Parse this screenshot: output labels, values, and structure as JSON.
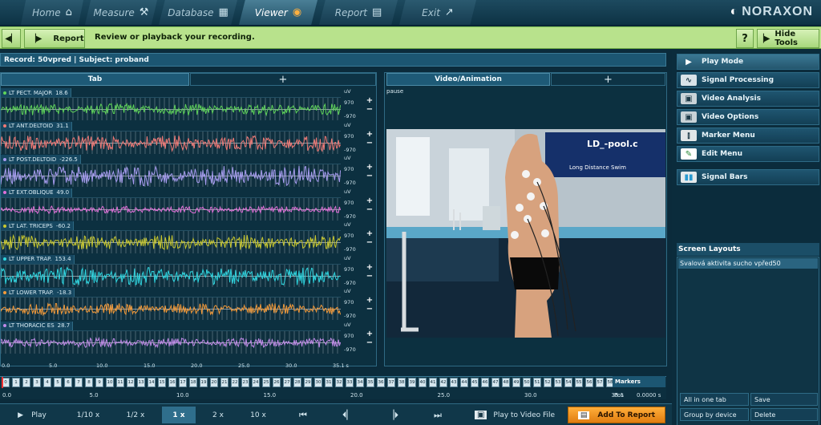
{
  "nav": {
    "tabs": [
      {
        "label": "Home",
        "icon": "home-icon"
      },
      {
        "label": "Measure",
        "icon": "measure-icon"
      },
      {
        "label": "Database",
        "icon": "database-icon"
      },
      {
        "label": "Viewer",
        "icon": "viewer-icon"
      },
      {
        "label": "Report",
        "icon": "report-icon"
      },
      {
        "label": "Exit",
        "icon": "exit-icon"
      }
    ],
    "active": "Viewer",
    "logo": "NORAXON"
  },
  "toolbar": {
    "report_label": "Report",
    "message": "Review or playback your recording.",
    "help": "?",
    "hide_tools": "Hide Tools"
  },
  "record": {
    "info": "Record: 50vpred | Subject: proband"
  },
  "signal_panel": {
    "tab_label": "Tab",
    "add_tab": "+",
    "unit": "uV",
    "scale_top": "970",
    "scale_bottom": "-970",
    "channels": [
      {
        "name": "LT PECT. MAJOR",
        "value": "18.6",
        "color": "#5fd35a"
      },
      {
        "name": "LT ANT.DELTOID",
        "value": "31.1",
        "color": "#f07a76"
      },
      {
        "name": "LT POST.DELTOID",
        "value": "-226.5",
        "color": "#a79cf0"
      },
      {
        "name": "LT EXT.OBLIQUE",
        "value": "49.0",
        "color": "#e070d8"
      },
      {
        "name": "LT LAT. TRICEPS",
        "value": "-60.2",
        "color": "#c9c830"
      },
      {
        "name": "LT UPPER TRAP.",
        "value": "153.4",
        "color": "#2fd6e0"
      },
      {
        "name": "LT LOWER TRAP.",
        "value": "-18.3",
        "color": "#f39a3a"
      },
      {
        "name": "LT THORACIC ES",
        "value": "28.7",
        "color": "#c08ae8"
      }
    ],
    "axis_ticks": [
      "0.0",
      "5.0",
      "10.0",
      "15.0",
      "20.0",
      "25.0",
      "30.0",
      "35.1 s"
    ]
  },
  "video_panel": {
    "tab_label": "Video/Animation",
    "add_tab": "+",
    "status": "pause",
    "banner_top": "LD_-pool.c",
    "banner_bottom": "Long Distance Swim"
  },
  "right_panel": {
    "items": [
      {
        "label": "Play Mode",
        "icon": "play-icon"
      },
      {
        "label": "Signal Processing",
        "icon": "signal-processing-icon"
      },
      {
        "label": "Video Analysis",
        "icon": "camera-icon"
      },
      {
        "label": "Video Options",
        "icon": "camera-icon"
      },
      {
        "label": "Marker Menu",
        "icon": "marker-icon"
      },
      {
        "label": "Edit Menu",
        "icon": "edit-icon"
      },
      {
        "label": "Signal Bars",
        "icon": "signal-bars-icon"
      }
    ],
    "screen_layouts_title": "Screen Layouts",
    "layouts": [
      "Svalová aktivita sucho vpřed50"
    ],
    "buttons": {
      "all_in_one_tab": "All in one tab",
      "save": "Save",
      "group_by_device": "Group by device",
      "delete": "Delete"
    }
  },
  "timeline": {
    "markers": [
      "0",
      "1",
      "2",
      "3",
      "4",
      "5",
      "6",
      "7",
      "8",
      "9",
      "10",
      "11",
      "12",
      "13",
      "14",
      "15",
      "16",
      "17",
      "18",
      "19",
      "20",
      "21",
      "22",
      "23",
      "24",
      "25",
      "26",
      "27",
      "28",
      "29",
      "30",
      "31",
      "32",
      "33",
      "34",
      "35",
      "36",
      "37",
      "38",
      "39",
      "40",
      "41",
      "42",
      "43",
      "44",
      "45",
      "46",
      "47",
      "48",
      "49",
      "50",
      "51",
      "52",
      "53",
      "54",
      "55",
      "56",
      "57",
      "58"
    ],
    "markers_label": "Markers",
    "ruler": [
      "0.0",
      "5.0",
      "10.0",
      "15.0",
      "20.0",
      "25.0",
      "30.0",
      "35.1"
    ],
    "pos_label": "Pos",
    "pos_value": "0.0000 s"
  },
  "playback": {
    "play": "Play",
    "speeds": [
      "1/10 x",
      "1/2 x",
      "1 x",
      "2 x",
      "10 x"
    ],
    "active_speed": "1 x",
    "play_to_video": "Play to Video File",
    "add_to_report": "Add To Report"
  }
}
